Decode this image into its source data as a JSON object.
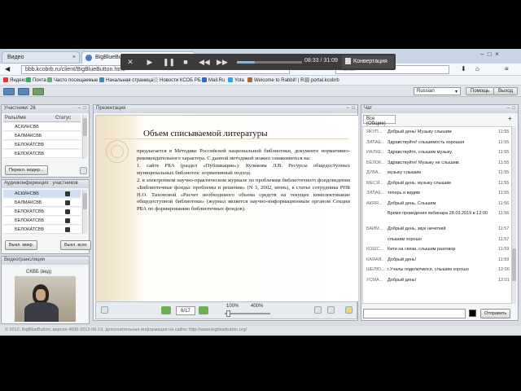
{
  "browser": {
    "tabs": [
      {
        "label": "Видео"
      },
      {
        "label": "BigBlueButton"
      }
    ],
    "url": "bbb.kcobrb.ru/client/BigBlueButton.html",
    "search_placeholder": "Поиск",
    "bookmarks": [
      "Яндекс",
      "Почта",
      "Часто посещаемые",
      "Начальная страница",
      "Новости КСОБ РБ",
      "Mail.Ru",
      "Yota",
      "Welcome to Rabbit! | R...",
      "portal.kcobrb"
    ]
  },
  "media": {
    "time": "08:33 / 31:09",
    "progress": 0.27,
    "convert_label": "Конвертация"
  },
  "toolbar": {
    "language": "Russian",
    "help_label": "Помощь",
    "logout_label": "Выход"
  },
  "participants": {
    "title": "Участники: 26",
    "columns": [
      "Роль",
      "Имя",
      "Статус"
    ],
    "rows": [
      "АСКИНСВБ",
      "БАЛМАКСВБ",
      "БЕЛОКАТСВБ",
      "БЕЛОКАТСВБ"
    ],
    "raise_button": "Перекл. модер..."
  },
  "listeners": {
    "title": "Аудиоконференция : участников",
    "rows": [
      "АСКИНСВБ",
      "БАЛМАКСВБ",
      "БЕЛОКАТСВБ",
      "БЕЛОКАТСВБ",
      "БЕЛОКАТСВБ"
    ],
    "mute_all": "Выкл. микр.",
    "mute_all_except": "Выкл. всех"
  },
  "webcam": {
    "title": "Видеотрансляции",
    "caption": "СКВБ (вед)"
  },
  "presentation": {
    "title": "Презентация",
    "slide_title": "Объем списываемой литературы",
    "paragraphs": [
      "предлагается в Методике Российской национальной библиотеки, документе нормативно-рекомендательного характера. С данной методикой можно ознакомиться на:",
      "1. сайте РБА (раздел «Публикации»): Куликова Л.В. Ресурсы общедоступных муниципальных библиотек: нормативный подход.",
      "2. в электронном научно-практическом журнале по проблемам библиотечного фондоведения «Библиотечные фонды: проблемы и решения» (N 3, 2002, июнь), в статье сотрудника РНБ Н.О. Тихоновой «Расчет необходимого объема средств на текущее комплектование общедоступной библиотеки» (журнал является научно-информационным органом Секции РБА по формированию библиотечных фондов)."
    ],
    "page": "6/17",
    "zoom_min": "100%",
    "zoom_max": "400%",
    "zoom_level": 0
  },
  "chat": {
    "title": "Чат",
    "tab_label": "Все (Общие)",
    "send_label": "Отправить",
    "messages": [
      {
        "name": "ЯКУП...",
        "text": "Добрый день! Музыку слышим",
        "time": "11:55"
      },
      {
        "name": "ЗИЛАЕ...",
        "text": "Здравствуйте! слышимость хорошая",
        "time": "11:55"
      },
      {
        "name": "ИАЛКЕ...",
        "text": "Здравствуйте, слышим музыку.",
        "time": "11:55"
      },
      {
        "name": "БЕЛОК...",
        "text": "Здравствуйте! Музыку не слышим.",
        "time": "11:55"
      },
      {
        "name": "ДУВА...",
        "text": "музыку слышим",
        "time": "11:55"
      },
      {
        "name": "МЕСЯ...",
        "text": "Добрый день. музыку слышим",
        "time": "11:55"
      },
      {
        "name": "ЗИЛАЕ...",
        "text": "теперь и видим",
        "time": "11:55"
      },
      {
        "name": "АКЯЯ...",
        "text": "Добрый день. Слышим.",
        "time": "11:56"
      },
      {
        "name": "",
        "text": "Время проведения вебинара 28.03.2019 в 12:00",
        "time": "11:56"
      },
      {
        "name": "БАЙМ...",
        "text": "Добрый день, звук нечеткий",
        "time": "11:57"
      },
      {
        "name": "",
        "text": "слышим хорошо",
        "time": "11:57"
      },
      {
        "name": "КОШС...",
        "text": "Кити на связи, слышим разговор",
        "time": "11:59"
      },
      {
        "name": "КАЯАЯ...",
        "text": "Добрый день!",
        "time": "11:59"
      },
      {
        "name": "ШЕЛЮ...",
        "text": "г.Учалы подключился, слышим хорошо",
        "time": "12:00"
      },
      {
        "name": "УСМА...",
        "text": "Добрый день!",
        "time": "12:01"
      }
    ]
  },
  "status_text": "© 2012, BigBlueButton, версия 4005-2012-06-19, дополнительная информация на сайте: http://www.bigbluebutton.org/"
}
